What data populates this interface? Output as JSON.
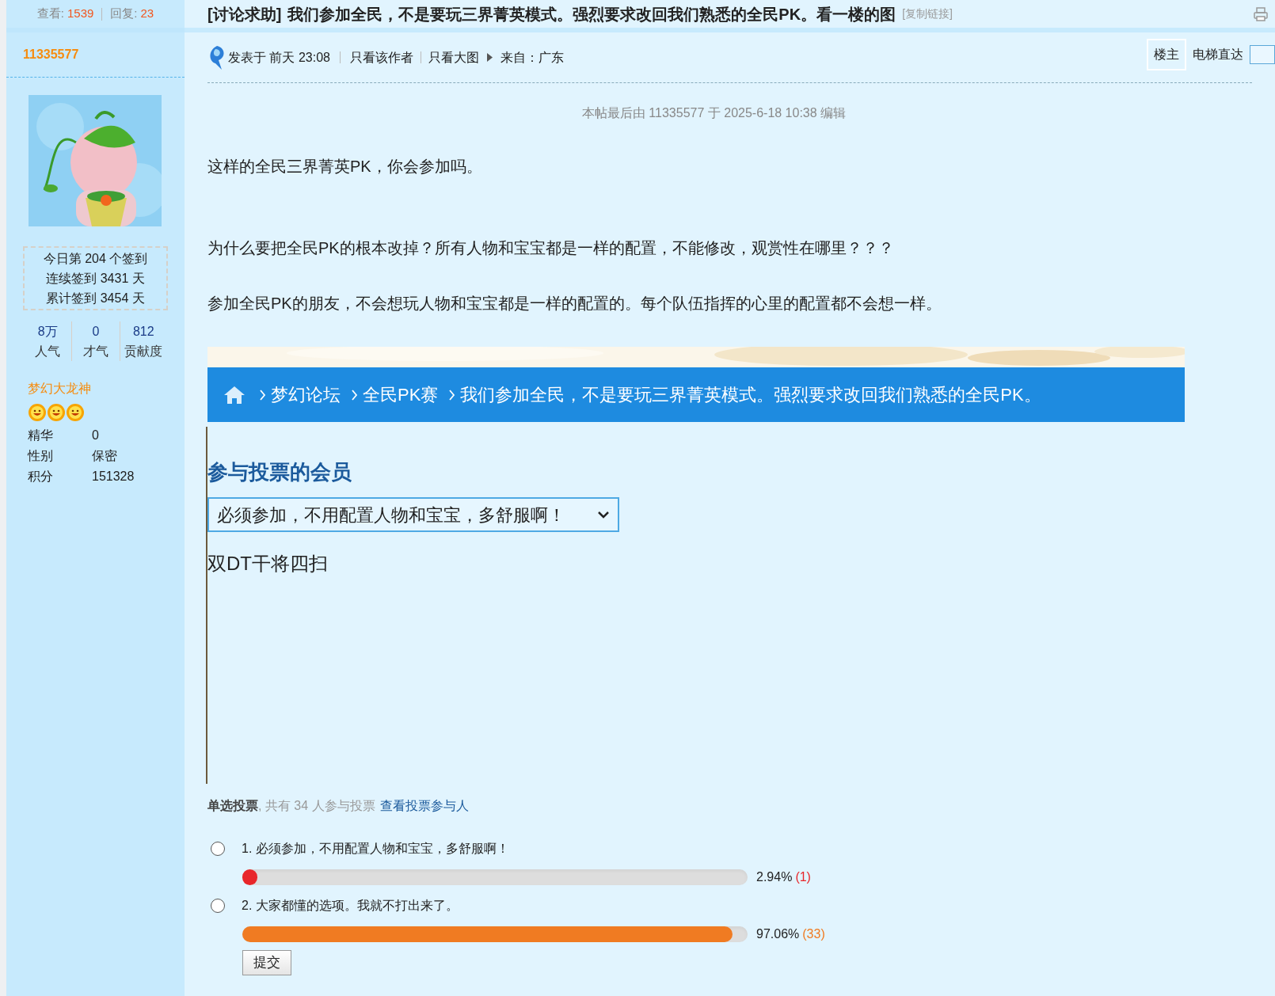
{
  "thread_stats": {
    "views_label": "查看:",
    "views": "1539",
    "replies_label": "回复:",
    "replies": "23"
  },
  "thread_title": {
    "tag": "[讨论求助]",
    "title": "我们参加全民，不是要玩三界菁英模式。强烈要求改回我们熟悉的全民PK。看一楼的图",
    "copy_link": "[复制链接]"
  },
  "author": {
    "name": "11335577",
    "checkin": [
      "今日第 204 个签到",
      "连续签到 3431 天",
      "累计签到 3454 天"
    ],
    "stats": [
      {
        "value": "8万",
        "label": "人气"
      },
      {
        "value": "0",
        "label": "才气"
      },
      {
        "value": "812",
        "label": "贡献度"
      }
    ],
    "rank": "梦幻大龙神",
    "stars": 3,
    "profile": [
      {
        "label": "精华",
        "value": "0"
      },
      {
        "label": "性别",
        "value": "保密"
      },
      {
        "label": "积分",
        "value": "151328"
      }
    ]
  },
  "post_meta": {
    "posted": "发表于 前天 23:08",
    "only_author": "只看该作者",
    "only_large": "只看大图",
    "from": "来自：广东",
    "floor": "楼主",
    "jump_label": "电梯直达"
  },
  "edit_note": "本帖最后由 11335577 于 2025-6-18 10:38 编辑",
  "paragraphs": [
    "这样的全民三界菁英PK，你会参加吗。",
    "为什么要把全民PK的根本改掉？所有人物和宝宝都是一样的配置，不能修改，观赏性在哪里？？？",
    "参加全民PK的朋友，不会想玩人物和宝宝都是一样的配置的。每个队伍指挥的心里的配置都不会想一样。"
  ],
  "embedded_screenshot": {
    "breadcrumb": [
      "梦幻论坛",
      "全民PK赛",
      "我们参加全民，不是要玩三界菁英模式。强烈要求改回我们熟悉的全民PK。"
    ],
    "heading": "参与投票的会员",
    "select_value": "必须参加，不用配置人物和宝宝，多舒服啊！",
    "text": "双DT干将四扫"
  },
  "poll": {
    "summary": "**单选投票**, 共有 34 人参与投票",
    "view_link": "查看投票参与人",
    "options": [
      {
        "number": "1.",
        "label": "必须参加，不用配置人物和宝宝，多舒服啊！",
        "selected": false,
        "level": 0.0294,
        "percent": "2.94%",
        "count": "(1)",
        "color": "#e8262a"
      },
      {
        "number": "2.",
        "label": "大家都懂的选项。我就不打出来了。",
        "selected": false,
        "level": 0.9706,
        "percent": "97.06%",
        "count": "(33)",
        "color": "#f07b22"
      }
    ],
    "submit": "提交"
  }
}
